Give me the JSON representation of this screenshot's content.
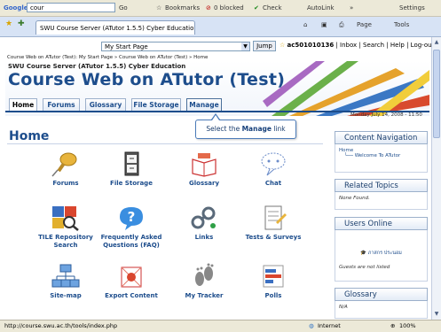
{
  "browser": {
    "google_label": "Google",
    "search_value": "cour",
    "toolbar_items": [
      "Go",
      "Bookmarks",
      "0 blocked",
      "Check",
      "AutoLink",
      "»",
      "Settings"
    ],
    "tab_title": "SWU Course Server (ATutor 1.5.5) Cyber Education :...",
    "nav_items": [
      "Page",
      "Tools"
    ],
    "status_url": "http://course.swu.ac.th/tools/index.php",
    "status_zone": "Internet",
    "status_zoom": "100%"
  },
  "page": {
    "jump_select": "My Start Page",
    "jump_button": "Jump",
    "user_links": [
      "ac501010136",
      "Inbox",
      "Search",
      "Help",
      "Log-out"
    ],
    "breadcrumb": "Course Web on ATutor (Test): My Start Page » Course Web on ATutor (Test) » Home",
    "site_name": "SWU Course Server (ATutor 1.5.5) Cyber Education",
    "course_title": "Course Web on ATutor (Test)",
    "tabs": [
      "Home",
      "Forums",
      "Glossary",
      "File Storage",
      "Manage"
    ],
    "date": "Monday July 14, 2008 - 11:50",
    "callout_prefix": "Select the ",
    "callout_bold": "Manage",
    "callout_suffix": " link",
    "heading": "Home",
    "tools": [
      "Forums",
      "File Storage",
      "Glossary",
      "Chat",
      "TILE Repository Search",
      "Frequently Asked Questions (FAQ)",
      "Links",
      "Tests & Surveys",
      "Site-map",
      "Export Content",
      "My Tracker",
      "Polls"
    ],
    "sidebar": {
      "content_nav_title": "Content Navigation",
      "content_nav_items": [
        "Home",
        "Welcome To ATutor"
      ],
      "related_title": "Related Topics",
      "related_body": "None Found.",
      "users_title": "Users Online",
      "users_name": "ภาสกร ประนอม",
      "users_note": "Guests are not listed",
      "glossary_title": "Glossary",
      "glossary_body": "N/A"
    }
  }
}
